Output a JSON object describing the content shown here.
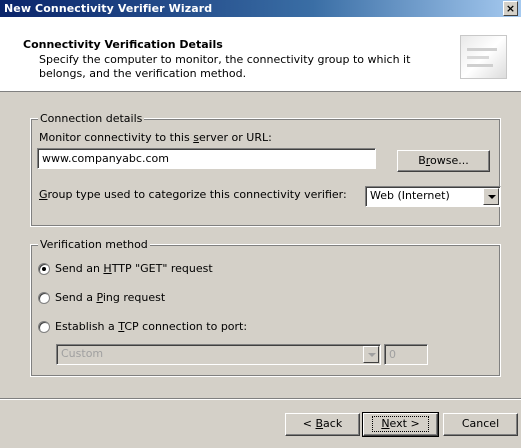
{
  "window": {
    "title": "New Connectivity Verifier Wizard",
    "close_glyph": "×"
  },
  "header": {
    "title": "Connectivity Verification Details",
    "description": "Specify the computer to monitor, the connectivity group to which it belongs, and the verification method."
  },
  "connection": {
    "group_label": "Connection details",
    "monitor_label_pre": "Monitor connectivity to this ",
    "monitor_label_u": "s",
    "monitor_label_post": "erver or URL:",
    "url_value": "www.companyabc.com",
    "browse_pre": "B",
    "browse_u": "r",
    "browse_post": "owse...",
    "group_type_label_u": "G",
    "group_type_label_post": "roup type used to categorize this connectivity verifier:",
    "group_type_value": "Web (Internet)"
  },
  "verification": {
    "group_label": "Verification method",
    "http": {
      "pre": "Send an ",
      "u": "H",
      "post": "TTP \"GET\" request",
      "checked": true
    },
    "ping": {
      "pre": "Send a ",
      "u": "P",
      "post": "ing request",
      "checked": false
    },
    "tcp": {
      "pre": "Establish a ",
      "u": "T",
      "post": "CP connection to port:",
      "checked": false
    },
    "port_combo_value": "Custom",
    "port_value": "0"
  },
  "footer": {
    "back_pre": "< ",
    "back_u": "B",
    "back_post": "ack",
    "next_u": "N",
    "next_post": "ext >",
    "cancel": "Cancel"
  }
}
